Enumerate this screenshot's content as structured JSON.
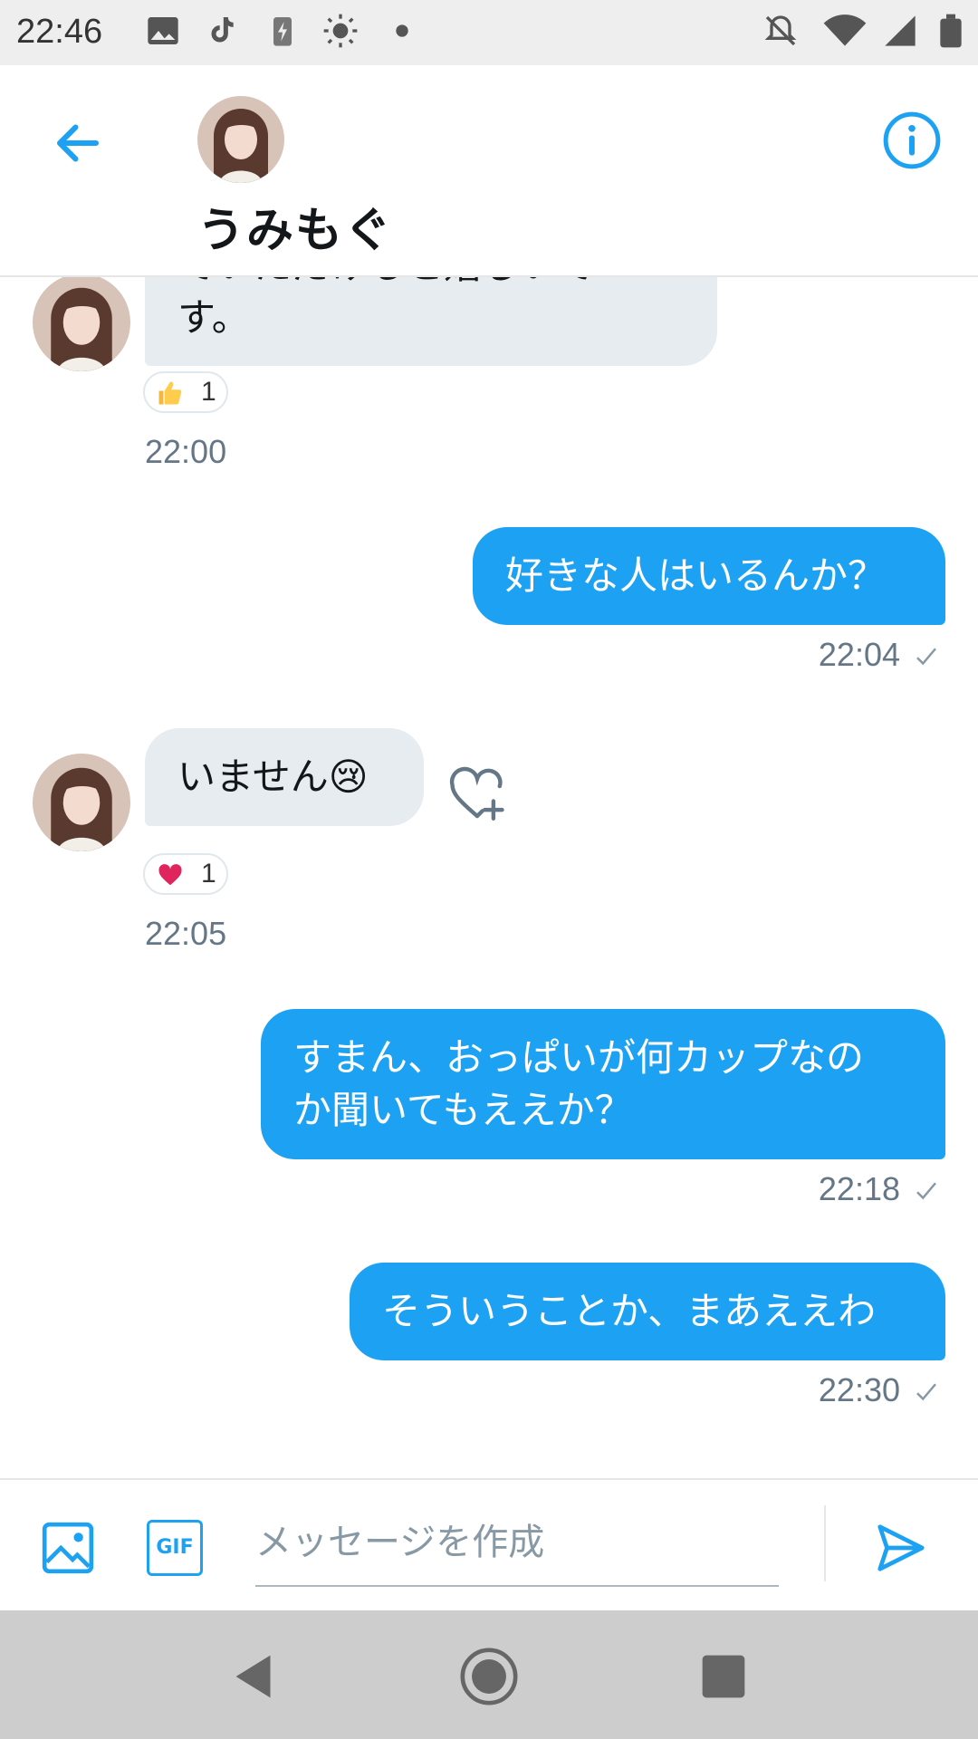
{
  "status_bar": {
    "time": "22:46",
    "icons": [
      "image-icon",
      "tiktok-icon",
      "battery-charging-icon",
      "brightness-icon",
      "dot-icon",
      "notifications-off-icon",
      "wifi-icon",
      "signal-icon",
      "battery-icon"
    ]
  },
  "header": {
    "title": "うみもぐ",
    "back_icon": "arrow-left-icon",
    "info_icon": "info-icon"
  },
  "messages": [
    {
      "side": "in",
      "text_lines": [
        "ていただけると嬉しいで",
        "す。"
      ],
      "reaction": {
        "icon": "thumbs-up-icon",
        "count": "1"
      },
      "time": "22:00"
    },
    {
      "side": "out",
      "text_lines": [
        "好きな人はいるんか？"
      ],
      "time": "22:04"
    },
    {
      "side": "in",
      "text_lines": [
        "いません😢"
      ],
      "reaction": {
        "icon": "heart-icon",
        "count": "1"
      },
      "time": "22:05"
    },
    {
      "side": "out",
      "text_lines": [
        "すまん、おっぱいが何カップなの",
        "か聞いてもええか？"
      ],
      "time": "22:18"
    },
    {
      "side": "out",
      "text_lines": [
        "そういうことか、まあええわ"
      ],
      "time": "22:30"
    }
  ],
  "composer": {
    "placeholder": "メッセージを作成",
    "gif_label": "GIF"
  },
  "colors": {
    "accent": "#1da1f2",
    "incoming_bubble": "#e6ecf0",
    "heart": "#e0245e"
  }
}
